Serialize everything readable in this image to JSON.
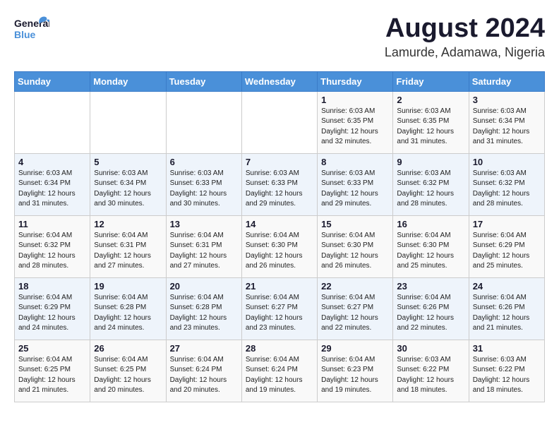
{
  "header": {
    "logo_general": "General",
    "logo_blue": "Blue",
    "month_year": "August 2024",
    "location": "Lamurde, Adamawa, Nigeria"
  },
  "days_of_week": [
    "Sunday",
    "Monday",
    "Tuesday",
    "Wednesday",
    "Thursday",
    "Friday",
    "Saturday"
  ],
  "weeks": [
    [
      {
        "day": "",
        "info": ""
      },
      {
        "day": "",
        "info": ""
      },
      {
        "day": "",
        "info": ""
      },
      {
        "day": "",
        "info": ""
      },
      {
        "day": "1",
        "info": "Sunrise: 6:03 AM\nSunset: 6:35 PM\nDaylight: 12 hours\nand 32 minutes."
      },
      {
        "day": "2",
        "info": "Sunrise: 6:03 AM\nSunset: 6:35 PM\nDaylight: 12 hours\nand 31 minutes."
      },
      {
        "day": "3",
        "info": "Sunrise: 6:03 AM\nSunset: 6:34 PM\nDaylight: 12 hours\nand 31 minutes."
      }
    ],
    [
      {
        "day": "4",
        "info": "Sunrise: 6:03 AM\nSunset: 6:34 PM\nDaylight: 12 hours\nand 31 minutes."
      },
      {
        "day": "5",
        "info": "Sunrise: 6:03 AM\nSunset: 6:34 PM\nDaylight: 12 hours\nand 30 minutes."
      },
      {
        "day": "6",
        "info": "Sunrise: 6:03 AM\nSunset: 6:33 PM\nDaylight: 12 hours\nand 30 minutes."
      },
      {
        "day": "7",
        "info": "Sunrise: 6:03 AM\nSunset: 6:33 PM\nDaylight: 12 hours\nand 29 minutes."
      },
      {
        "day": "8",
        "info": "Sunrise: 6:03 AM\nSunset: 6:33 PM\nDaylight: 12 hours\nand 29 minutes."
      },
      {
        "day": "9",
        "info": "Sunrise: 6:03 AM\nSunset: 6:32 PM\nDaylight: 12 hours\nand 28 minutes."
      },
      {
        "day": "10",
        "info": "Sunrise: 6:03 AM\nSunset: 6:32 PM\nDaylight: 12 hours\nand 28 minutes."
      }
    ],
    [
      {
        "day": "11",
        "info": "Sunrise: 6:04 AM\nSunset: 6:32 PM\nDaylight: 12 hours\nand 28 minutes."
      },
      {
        "day": "12",
        "info": "Sunrise: 6:04 AM\nSunset: 6:31 PM\nDaylight: 12 hours\nand 27 minutes."
      },
      {
        "day": "13",
        "info": "Sunrise: 6:04 AM\nSunset: 6:31 PM\nDaylight: 12 hours\nand 27 minutes."
      },
      {
        "day": "14",
        "info": "Sunrise: 6:04 AM\nSunset: 6:30 PM\nDaylight: 12 hours\nand 26 minutes."
      },
      {
        "day": "15",
        "info": "Sunrise: 6:04 AM\nSunset: 6:30 PM\nDaylight: 12 hours\nand 26 minutes."
      },
      {
        "day": "16",
        "info": "Sunrise: 6:04 AM\nSunset: 6:30 PM\nDaylight: 12 hours\nand 25 minutes."
      },
      {
        "day": "17",
        "info": "Sunrise: 6:04 AM\nSunset: 6:29 PM\nDaylight: 12 hours\nand 25 minutes."
      }
    ],
    [
      {
        "day": "18",
        "info": "Sunrise: 6:04 AM\nSunset: 6:29 PM\nDaylight: 12 hours\nand 24 minutes."
      },
      {
        "day": "19",
        "info": "Sunrise: 6:04 AM\nSunset: 6:28 PM\nDaylight: 12 hours\nand 24 minutes."
      },
      {
        "day": "20",
        "info": "Sunrise: 6:04 AM\nSunset: 6:28 PM\nDaylight: 12 hours\nand 23 minutes."
      },
      {
        "day": "21",
        "info": "Sunrise: 6:04 AM\nSunset: 6:27 PM\nDaylight: 12 hours\nand 23 minutes."
      },
      {
        "day": "22",
        "info": "Sunrise: 6:04 AM\nSunset: 6:27 PM\nDaylight: 12 hours\nand 22 minutes."
      },
      {
        "day": "23",
        "info": "Sunrise: 6:04 AM\nSunset: 6:26 PM\nDaylight: 12 hours\nand 22 minutes."
      },
      {
        "day": "24",
        "info": "Sunrise: 6:04 AM\nSunset: 6:26 PM\nDaylight: 12 hours\nand 21 minutes."
      }
    ],
    [
      {
        "day": "25",
        "info": "Sunrise: 6:04 AM\nSunset: 6:25 PM\nDaylight: 12 hours\nand 21 minutes."
      },
      {
        "day": "26",
        "info": "Sunrise: 6:04 AM\nSunset: 6:25 PM\nDaylight: 12 hours\nand 20 minutes."
      },
      {
        "day": "27",
        "info": "Sunrise: 6:04 AM\nSunset: 6:24 PM\nDaylight: 12 hours\nand 20 minutes."
      },
      {
        "day": "28",
        "info": "Sunrise: 6:04 AM\nSunset: 6:24 PM\nDaylight: 12 hours\nand 19 minutes."
      },
      {
        "day": "29",
        "info": "Sunrise: 6:04 AM\nSunset: 6:23 PM\nDaylight: 12 hours\nand 19 minutes."
      },
      {
        "day": "30",
        "info": "Sunrise: 6:03 AM\nSunset: 6:22 PM\nDaylight: 12 hours\nand 18 minutes."
      },
      {
        "day": "31",
        "info": "Sunrise: 6:03 AM\nSunset: 6:22 PM\nDaylight: 12 hours\nand 18 minutes."
      }
    ]
  ]
}
